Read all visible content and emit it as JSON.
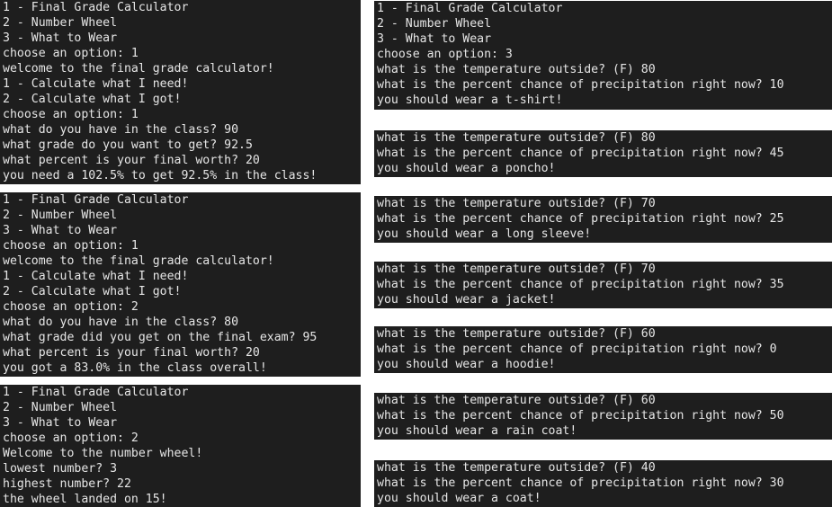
{
  "colors": {
    "terminal_background": "#1e1e1e",
    "terminal_text": "#e6e6e6",
    "page_background": "#ffffff"
  },
  "panels": {
    "grade_need": {
      "lines": [
        "1 - Final Grade Calculator",
        "2 - Number Wheel",
        "3 - What to Wear",
        "choose an option: 1",
        "welcome to the final grade calculator!",
        "1 - Calculate what I need!",
        "2 - Calculate what I got!",
        "choose an option: 1",
        "what do you have in the class? 90",
        "what grade do you want to get? 92.5",
        "what percent is your final worth? 20",
        "you need a 102.5% to get 92.5% in the class!"
      ]
    },
    "grade_got": {
      "lines": [
        "1 - Final Grade Calculator",
        "2 - Number Wheel",
        "3 - What to Wear",
        "choose an option: 1",
        "welcome to the final grade calculator!",
        "1 - Calculate what I need!",
        "2 - Calculate what I got!",
        "choose an option: 2",
        "what do you have in the class? 80",
        "what grade did you get on the final exam? 95",
        "what percent is your final worth? 20",
        "you got a 83.0% in the class overall!"
      ]
    },
    "number_wheel": {
      "lines": [
        "1 - Final Grade Calculator",
        "2 - Number Wheel",
        "3 - What to Wear",
        "choose an option: 2",
        "Welcome to the number wheel!",
        "lowest number? 3",
        "highest number? 22",
        "the wheel landed on 15!"
      ]
    },
    "wear_tshirt": {
      "lines": [
        "1 - Final Grade Calculator",
        "2 - Number Wheel",
        "3 - What to Wear",
        "choose an option: 3",
        "what is the temperature outside? (F) 80",
        "what is the percent chance of precipitation right now? 10",
        "you should wear a t-shirt!"
      ]
    },
    "wear_poncho": {
      "lines": [
        "what is the temperature outside? (F) 80",
        "what is the percent chance of precipitation right now? 45",
        "you should wear a poncho!"
      ]
    },
    "wear_long_sleeve": {
      "lines": [
        "what is the temperature outside? (F) 70",
        "what is the percent chance of precipitation right now? 25",
        "you should wear a long sleeve!"
      ]
    },
    "wear_jacket": {
      "lines": [
        "what is the temperature outside? (F) 70",
        "what is the percent chance of precipitation right now? 35",
        "you should wear a jacket!"
      ]
    },
    "wear_hoodie": {
      "lines": [
        "what is the temperature outside? (F) 60",
        "what is the percent chance of precipitation right now? 0",
        "you should wear a hoodie!"
      ]
    },
    "wear_rain_coat": {
      "lines": [
        "what is the temperature outside? (F) 60",
        "what is the percent chance of precipitation right now? 50",
        "you should wear a rain coat!"
      ]
    },
    "wear_coat": {
      "lines": [
        "what is the temperature outside? (F) 40",
        "what is the percent chance of precipitation right now? 30",
        "you should wear a coat!"
      ]
    }
  }
}
